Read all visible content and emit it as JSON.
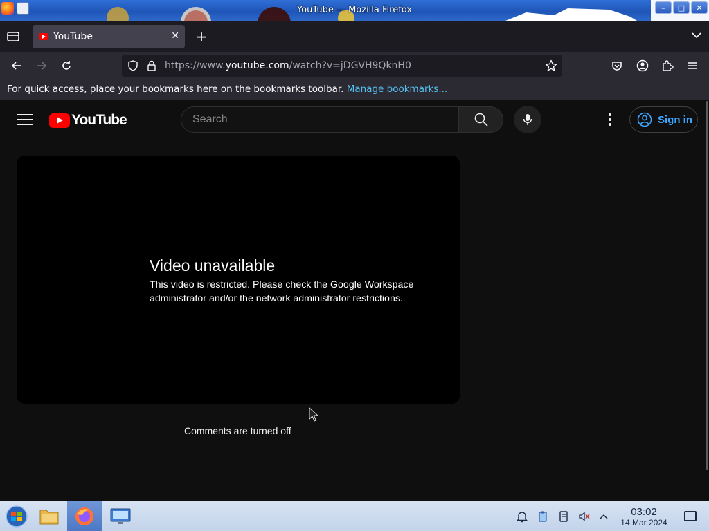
{
  "window": {
    "title": "YouTube — Mozilla Firefox",
    "minimize_label": "–",
    "maximize_label": "□",
    "close_label": "✕"
  },
  "tabs": [
    {
      "label": "YouTube",
      "close_label": "✕"
    }
  ],
  "new_tab_label": "+",
  "url": {
    "prefix": "https://www.",
    "host": "youtube.com",
    "path": "/watch?v=jDGVH9QknH0"
  },
  "bookmarks_bar": {
    "message": "For quick access, place your bookmarks here on the bookmarks toolbar. ",
    "link": "Manage bookmarks..."
  },
  "youtube": {
    "logo_text": "YouTube",
    "search_placeholder": "Search",
    "sign_in_label": "Sign in",
    "video_title": "Video unavailable",
    "video_message": "This video is restricted. Please check the Google Workspace administrator and/or the network administrator restrictions.",
    "comments_status": "Comments are turned off"
  },
  "taskbar": {
    "time": "03:02",
    "date": "14 Mar 2024"
  },
  "colors": {
    "yt_red": "#ff0000",
    "link_blue": "#54c2f0",
    "signin_blue": "#3ea6ff",
    "firefox_dark": "#1c1b22"
  }
}
